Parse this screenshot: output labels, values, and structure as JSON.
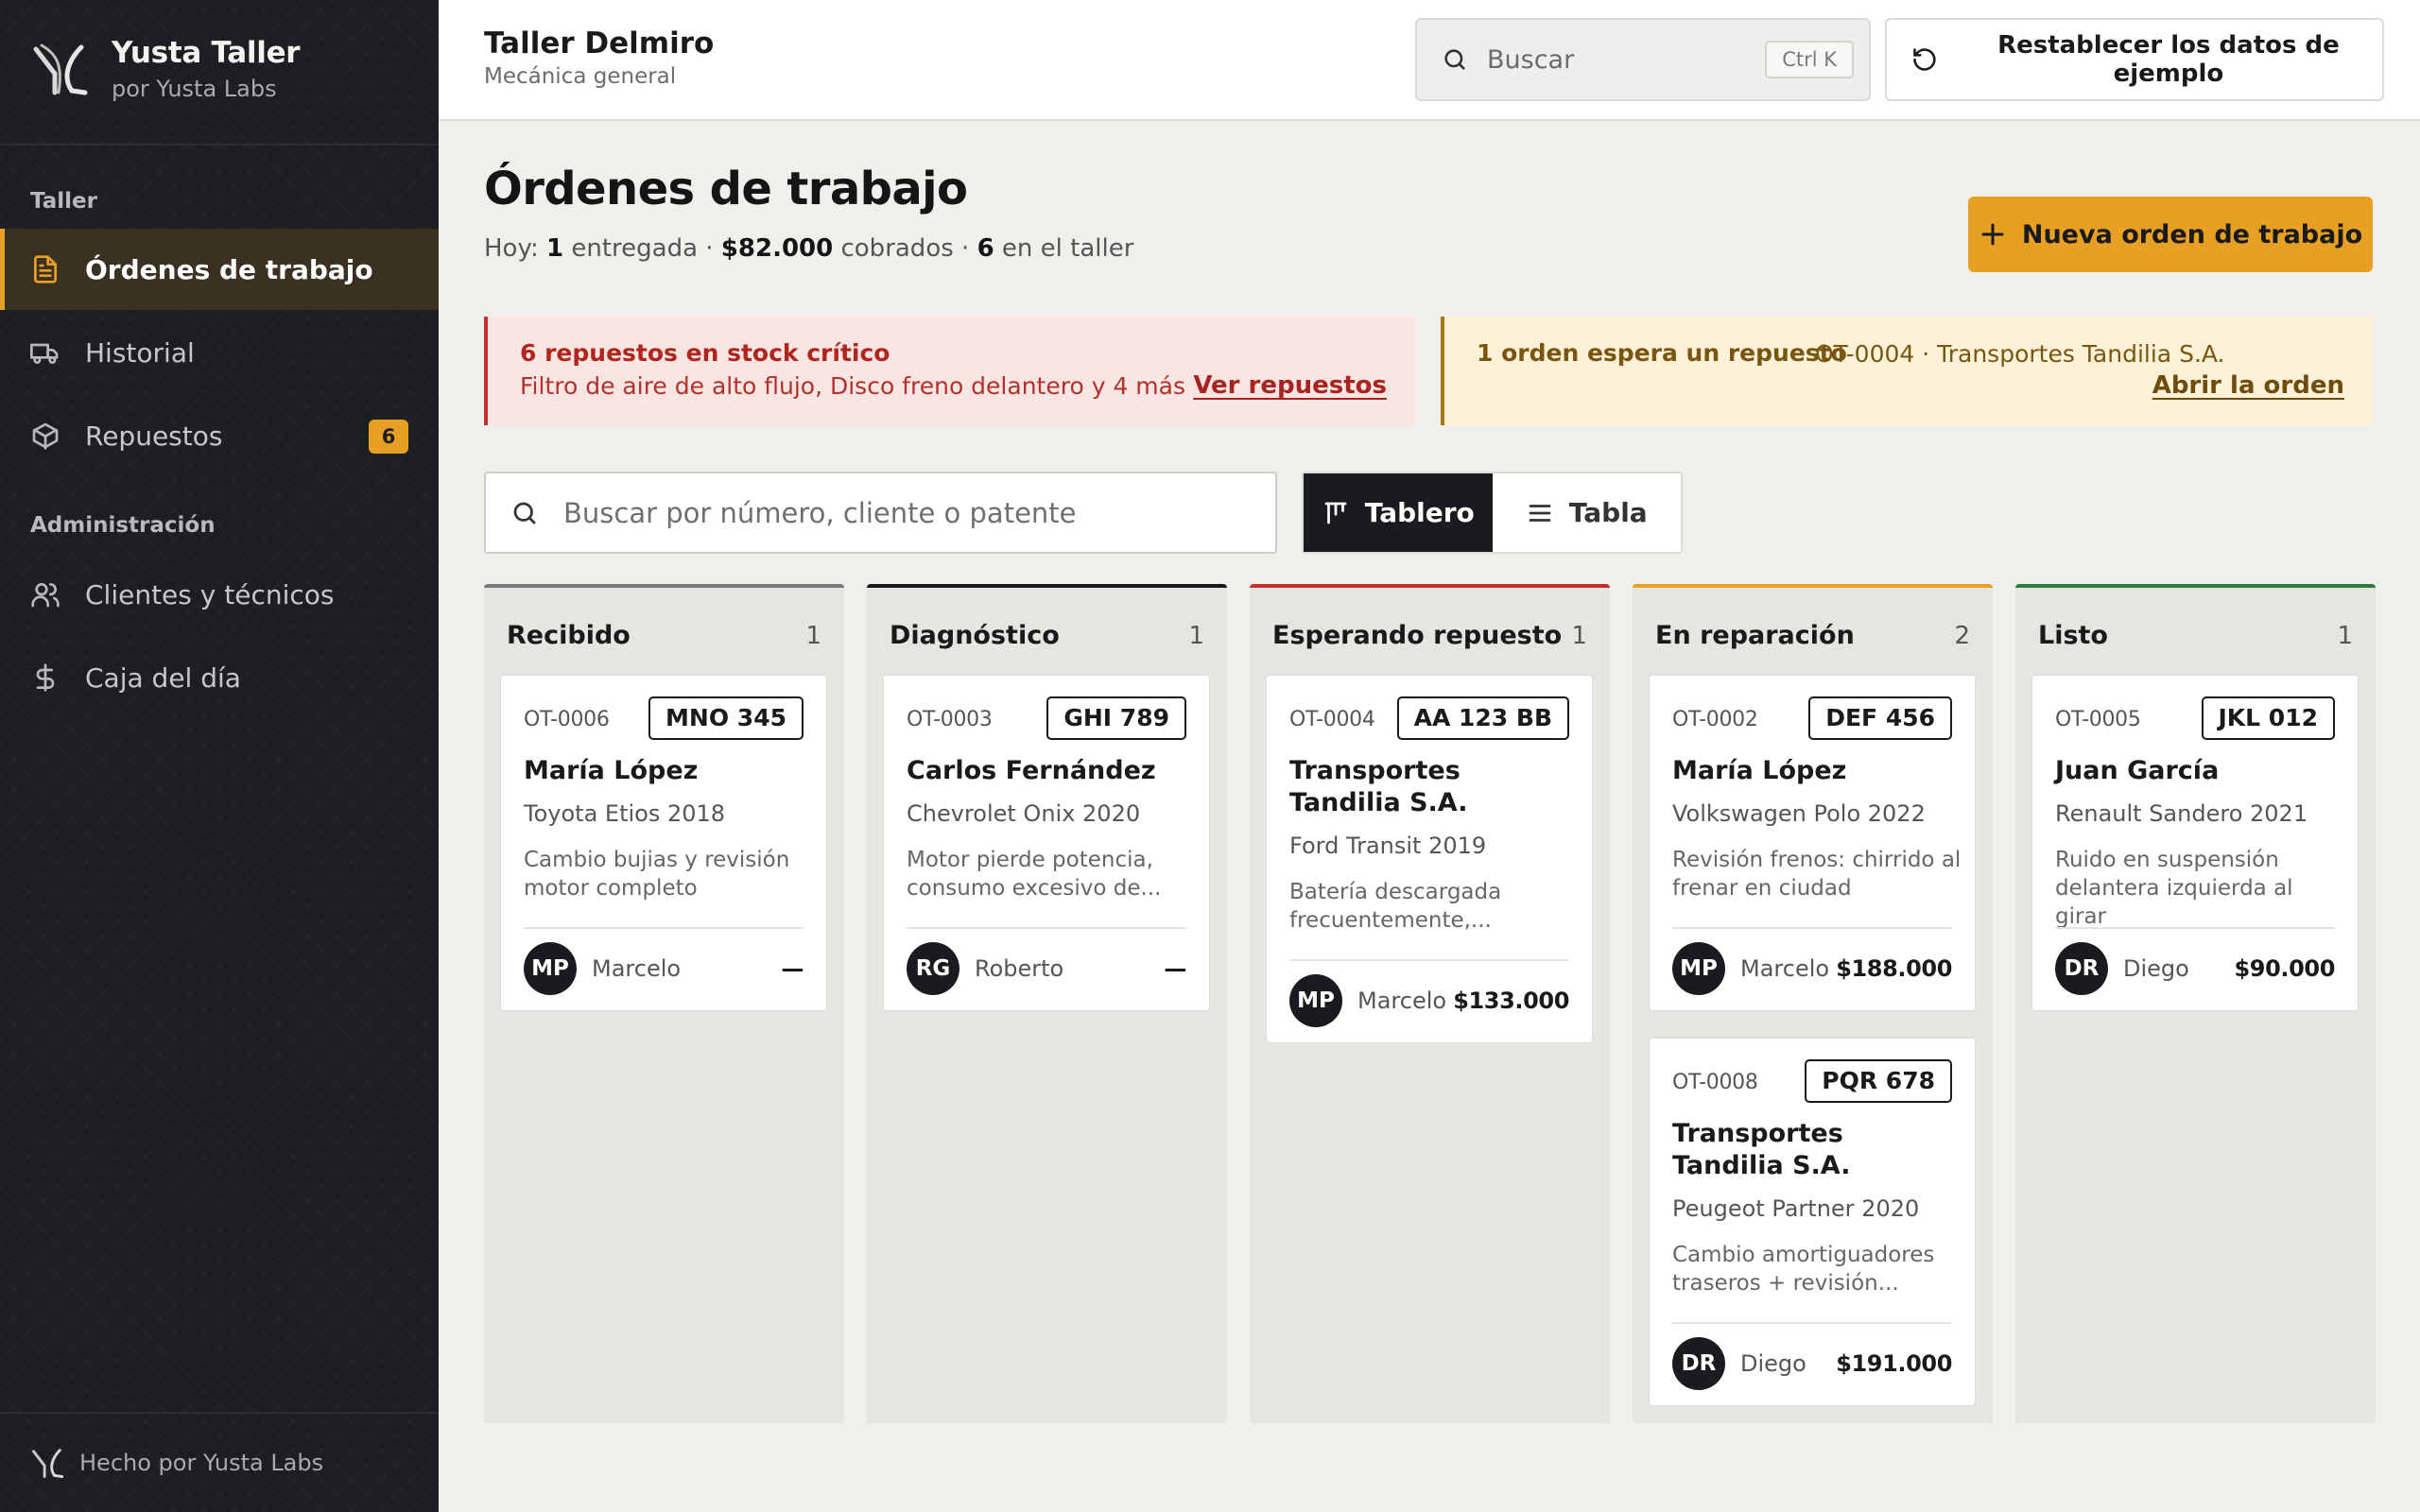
{
  "brand": {
    "title": "Yusta Taller",
    "subtitle": "por Yusta Labs"
  },
  "sidebar": {
    "sections": [
      {
        "label": "Taller",
        "items": [
          {
            "label": "Órdenes de trabajo",
            "icon": "document-icon",
            "active": true
          },
          {
            "label": "Historial",
            "icon": "truck-icon"
          },
          {
            "label": "Repuestos",
            "icon": "box-icon",
            "badge": "6"
          }
        ]
      },
      {
        "label": "Administración",
        "items": [
          {
            "label": "Clientes y técnicos",
            "icon": "users-icon"
          },
          {
            "label": "Caja del día",
            "icon": "dollar-icon"
          }
        ]
      }
    ],
    "footer": "Hecho por Yusta Labs"
  },
  "topbar": {
    "shop_name": "Taller Delmiro",
    "shop_sub": "Mecánica general",
    "search_placeholder": "Buscar",
    "search_shortcut": "Ctrl K",
    "reset_label": "Restablecer los datos de ejemplo"
  },
  "header": {
    "title": "Órdenes de trabajo",
    "summary": {
      "prefix": "Hoy: ",
      "delivered": "1",
      "delivered_label": " entregada · ",
      "collected": "$82.000",
      "collected_label": " cobrados · ",
      "in_shop": "6",
      "in_shop_label": " en el taller"
    },
    "new_order_label": "Nueva orden de trabajo"
  },
  "alerts": {
    "critical": {
      "title": "6 repuestos en stock crítico",
      "body": "Filtro de aire de alto flujo, Disco freno delantero y 4 más",
      "link": "Ver repuestos"
    },
    "waiting": {
      "title": "1 orden espera un repuesto",
      "ref": "OT-0004 · Transportes Tandilia S.A.",
      "link": "Abrir la orden"
    }
  },
  "toolbar": {
    "search_placeholder": "Buscar por número, cliente o patente",
    "views": [
      "Tablero",
      "Tabla"
    ],
    "active_view": "Tablero"
  },
  "colors": {
    "accent": "#e8a024",
    "sidebar": "#1d1e21",
    "critical": "#c0322b",
    "warning": "#a5781b"
  },
  "board": {
    "columns": [
      {
        "title": "Recibido",
        "count": "1",
        "color": "#7a7a7a",
        "cards": [
          {
            "ot": "OT-0006",
            "plate": "MNO 345",
            "customer": "María López",
            "vehicle": "Toyota Etios 2018",
            "desc": "Cambio bujias y revisión motor completo",
            "initials": "MP",
            "tech": "Marcelo",
            "amount": "—"
          }
        ]
      },
      {
        "title": "Diagnóstico",
        "count": "1",
        "color": "#1a1a1a",
        "cards": [
          {
            "ot": "OT-0003",
            "plate": "GHI 789",
            "customer": "Carlos Fernández",
            "vehicle": "Chevrolet Onix 2020",
            "desc": "Motor pierde potencia, consumo excesivo de...",
            "initials": "RG",
            "tech": "Roberto",
            "amount": "—"
          }
        ]
      },
      {
        "title": "Esperando repuesto",
        "count": "1",
        "color": "#c0322b",
        "cards": [
          {
            "ot": "OT-0004",
            "plate": "AA 123 BB",
            "customer": "Transportes Tandilia S.A.",
            "vehicle": "Ford Transit 2019",
            "desc": "Batería descargada frecuentemente,...",
            "initials": "MP",
            "tech": "Marcelo",
            "amount": "$133.000"
          }
        ]
      },
      {
        "title": "En reparación",
        "count": "2",
        "color": "#e8a024",
        "cards": [
          {
            "ot": "OT-0002",
            "plate": "DEF 456",
            "customer": "María López",
            "vehicle": "Volkswagen Polo 2022",
            "desc": "Revisión frenos: chirrido al frenar en ciudad",
            "initials": "MP",
            "tech": "Marcelo",
            "amount": "$188.000"
          },
          {
            "ot": "OT-0008",
            "plate": "PQR 678",
            "customer": "Transportes Tandilia S.A.",
            "vehicle": "Peugeot Partner 2020",
            "desc": "Cambio amortiguadores traseros + revisión...",
            "initials": "DR",
            "tech": "Diego",
            "amount": "$191.000"
          }
        ]
      },
      {
        "title": "Listo",
        "count": "1",
        "color": "#2e7d3a",
        "cards": [
          {
            "ot": "OT-0005",
            "plate": "JKL 012",
            "customer": "Juan García",
            "vehicle": "Renault Sandero 2021",
            "desc": "Ruido en suspensión delantera izquierda al girar",
            "initials": "DR",
            "tech": "Diego",
            "amount": "$90.000"
          }
        ]
      }
    ]
  }
}
